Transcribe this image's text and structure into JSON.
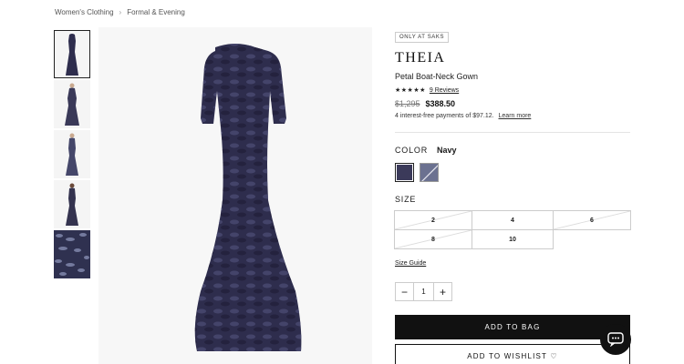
{
  "breadcrumb": [
    "Women's Clothing",
    "Formal & Evening"
  ],
  "breadcrumb_separator": "›",
  "product": {
    "badge": "ONLY AT SAKS",
    "brand": "THEIA",
    "name": "Petal Boat-Neck Gown",
    "rating_stars": "★★★★★",
    "rating_value": 4.5,
    "reviews": "9 Reviews",
    "original_price": "$1,295",
    "sale_price": "$388.50",
    "installments": "4 interest-free payments of $97.12.",
    "learn_more": "Learn more"
  },
  "color": {
    "label": "COLOR",
    "selected": "Navy",
    "swatches": [
      "#3b3a5a",
      "#6b7190"
    ]
  },
  "size": {
    "label": "SIZE",
    "options": [
      "2",
      "4",
      "6",
      "8",
      "10"
    ],
    "guide": "Size Guide"
  },
  "quantity": {
    "minus": "−",
    "value": "1",
    "plus": "+"
  },
  "actions": {
    "add_to_bag": "ADD TO BAG",
    "wishlist": "ADD TO WISHLIST ♡"
  },
  "icons": {
    "chat": "chat-bubble-icon",
    "breadcrumb_sep": "chevron-right-icon"
  },
  "colors": {
    "dress": "#2e2d4d",
    "accent": "#111111"
  }
}
